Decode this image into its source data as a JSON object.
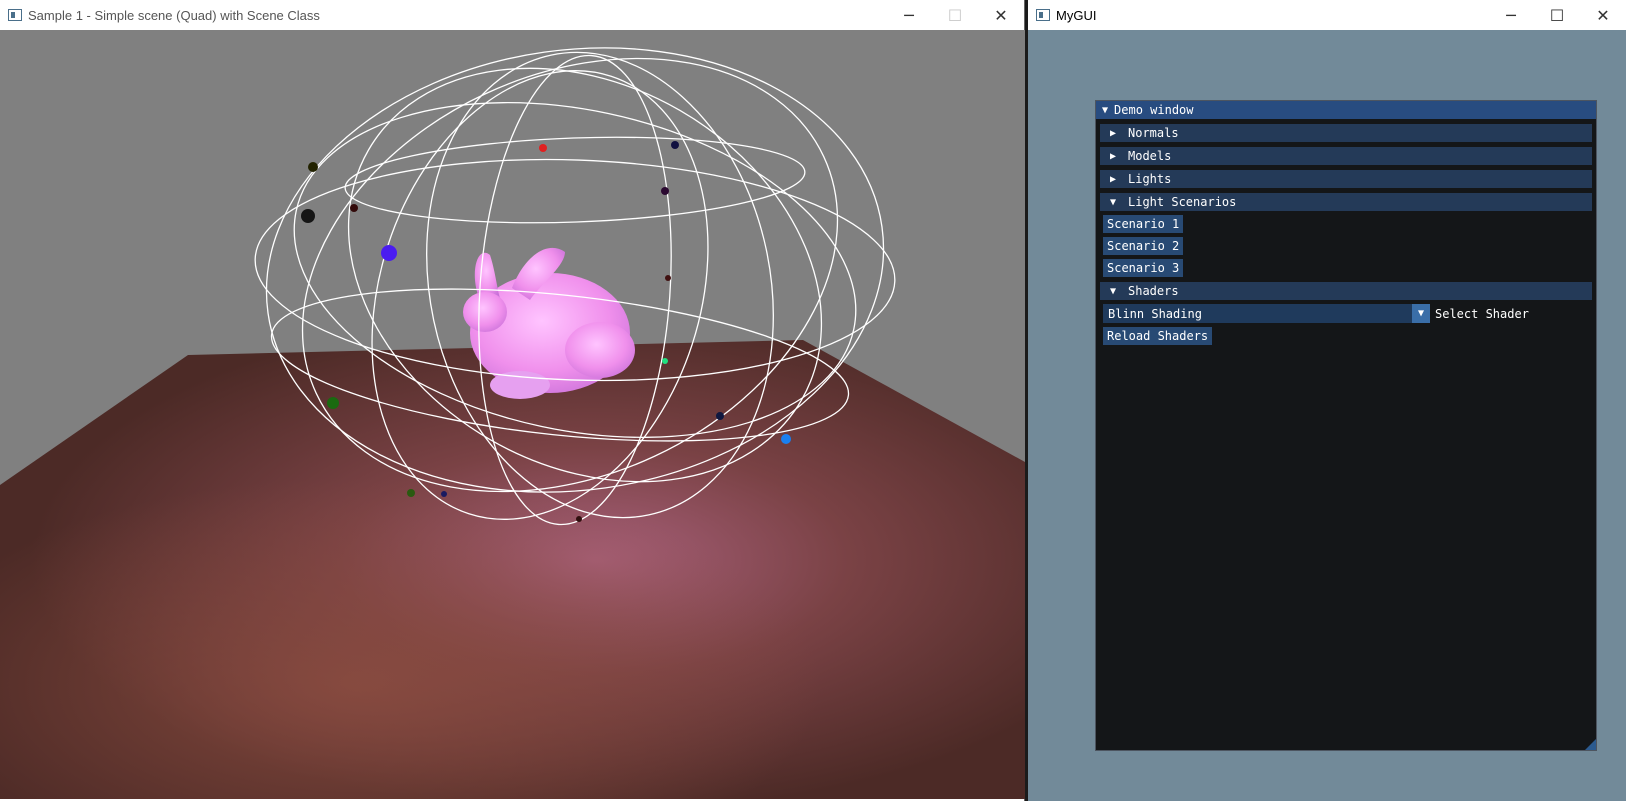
{
  "left_window": {
    "title": "Sample 1 - Simple scene (Quad) with Scene Class",
    "controls": {
      "minimize": "─",
      "maximize": "☐",
      "close": "✕"
    }
  },
  "right_window": {
    "title": "MyGUI",
    "controls": {
      "minimize": "─",
      "maximize": "☐",
      "close": "✕"
    }
  },
  "demo_window": {
    "title": "Demo window",
    "title_arrow": "▼",
    "sections": {
      "normals": {
        "label": "Normals",
        "arrow": "▶"
      },
      "models": {
        "label": "Models",
        "arrow": "▶"
      },
      "lights": {
        "label": "Lights",
        "arrow": "▶"
      },
      "light_scenarios": {
        "label": "Light Scenarios",
        "arrow": "▼"
      },
      "shaders": {
        "label": "Shaders",
        "arrow": "▼"
      }
    },
    "scenario_buttons": [
      "Scenario 1",
      "Scenario 2",
      "Scenario 3"
    ],
    "shader_combo": {
      "value": "Blinn Shading",
      "label": "Select Shader",
      "arrow": "▼"
    },
    "reload_button": "Reload Shaders"
  },
  "colors": {
    "sky": "#808080",
    "floor": "#6e3a38",
    "bunny": "#f3a0f0",
    "wireframe": "#ffffff",
    "imgui_bg": "#141618",
    "imgui_title": "#284c80",
    "client_bg": "#728a99"
  }
}
